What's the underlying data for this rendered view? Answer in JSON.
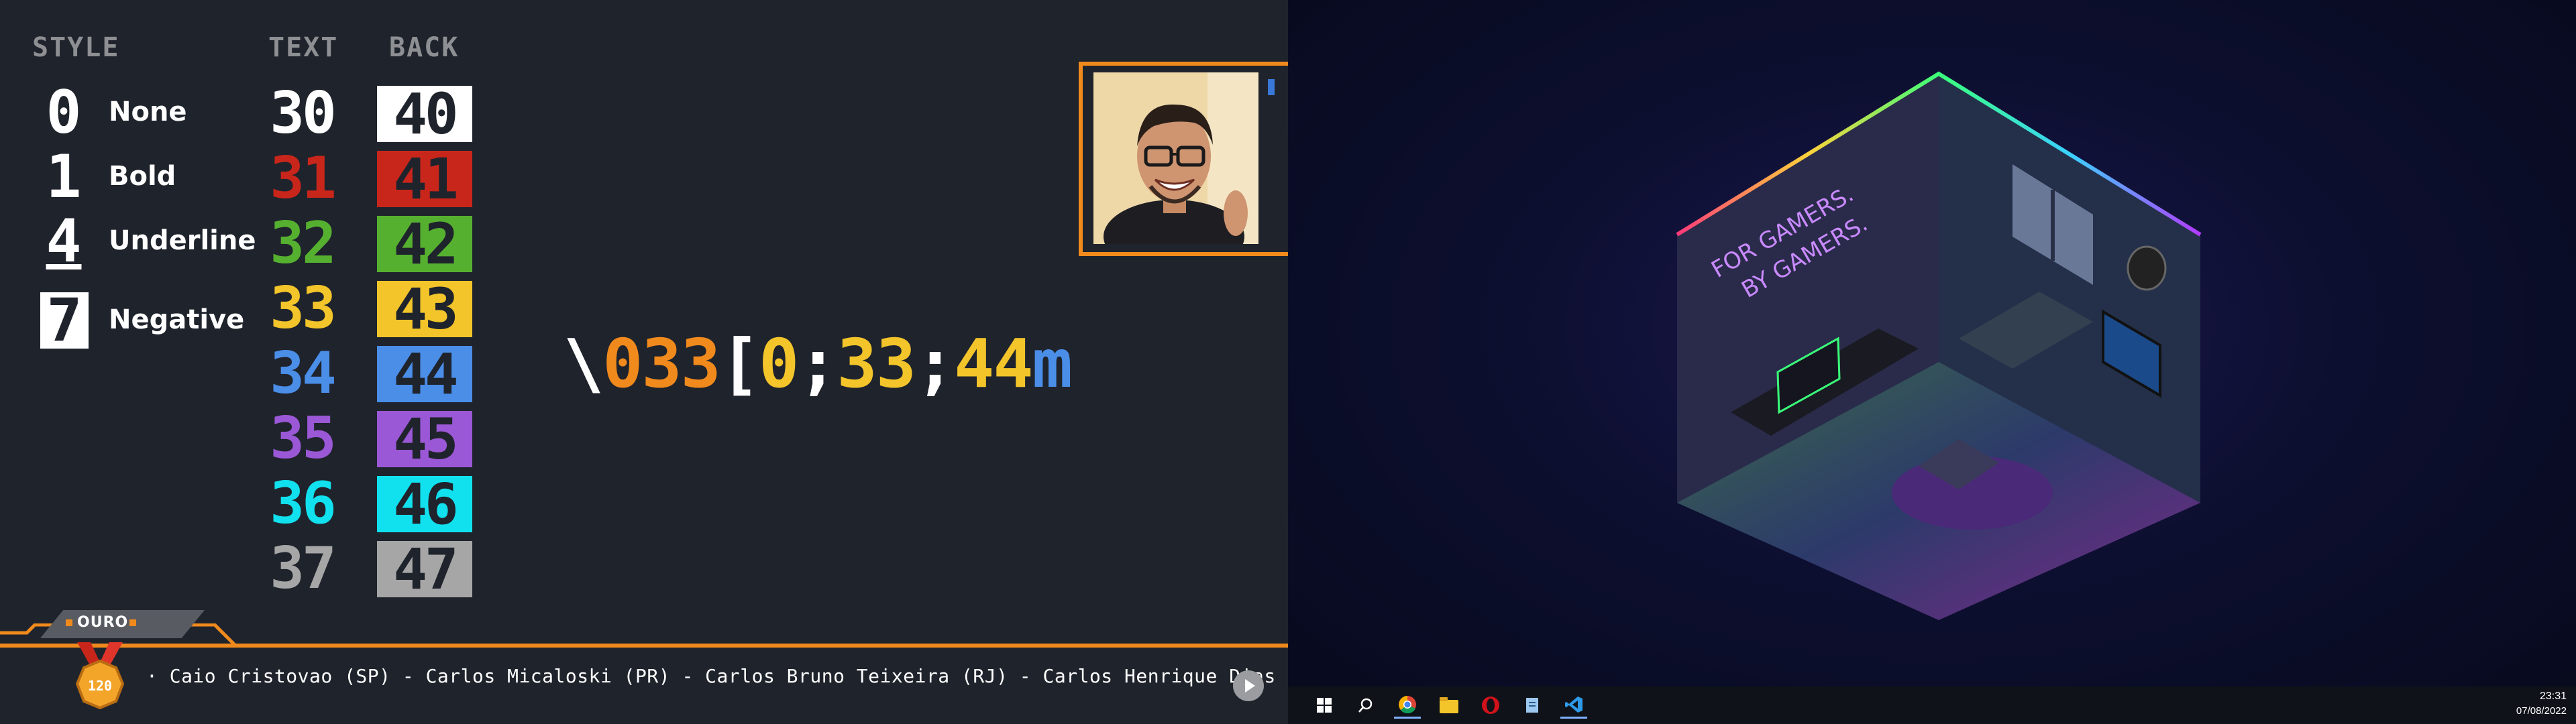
{
  "overlay": {
    "headers": {
      "style": "STYLE",
      "text": "TEXT",
      "back": "BACK"
    },
    "styles": [
      {
        "code": "0",
        "label": "None"
      },
      {
        "code": "1",
        "label": "Bold"
      },
      {
        "code": "4",
        "label": "Underline"
      },
      {
        "code": "7",
        "label": "Negative"
      }
    ],
    "text_codes": [
      {
        "code": "30",
        "color": "#ffffff"
      },
      {
        "code": "31",
        "color": "#c9261b"
      },
      {
        "code": "32",
        "color": "#56b030"
      },
      {
        "code": "33",
        "color": "#f3c52a"
      },
      {
        "code": "34",
        "color": "#4a8ee8"
      },
      {
        "code": "35",
        "color": "#9b58d6"
      },
      {
        "code": "36",
        "color": "#11e1ee"
      },
      {
        "code": "37",
        "color": "#a6a6a6"
      }
    ],
    "back_codes": [
      {
        "code": "40",
        "color": "#ffffff"
      },
      {
        "code": "41",
        "color": "#c9261b"
      },
      {
        "code": "42",
        "color": "#56b030"
      },
      {
        "code": "43",
        "color": "#f3c52a"
      },
      {
        "code": "44",
        "color": "#4a8ee8"
      },
      {
        "code": "45",
        "color": "#9b58d6"
      },
      {
        "code": "46",
        "color": "#11e1ee"
      },
      {
        "code": "47",
        "color": "#a6a6a6"
      }
    ],
    "sequence": [
      {
        "text": "\\",
        "color": "#ffffff"
      },
      {
        "text": "033",
        "color": "#f08a1c"
      },
      {
        "text": "[",
        "color": "#ffffff"
      },
      {
        "text": "0",
        "color": "#f3c52a"
      },
      {
        "text": ";",
        "color": "#ffffff"
      },
      {
        "text": "33",
        "color": "#f3c52a"
      },
      {
        "text": ";",
        "color": "#ffffff"
      },
      {
        "text": "44",
        "color": "#f3c52a"
      },
      {
        "text": "m",
        "color": "#4a8ee8"
      }
    ],
    "ticker": {
      "tier": "OURO",
      "medal_number": "120",
      "names": "· Caio Cristovao (SP) - Carlos Micaloski (PR) - Carlos Bruno Teixeira (RJ) - Carlos Henrique Dias (RS)"
    },
    "colors": {
      "accent": "#f08a1c",
      "background": "#1f232c"
    }
  },
  "desktop": {
    "wallpaper": {
      "neon_line1": "FOR GAMERS.",
      "neon_line2": "BY GAMERS."
    },
    "taskbar": {
      "icons": [
        "windows-start-icon",
        "search-icon",
        "chrome-icon",
        "file-explorer-icon",
        "opera-icon",
        "notepad-icon",
        "vscode-icon"
      ],
      "time": "23:31",
      "date": "07/08/2022"
    }
  }
}
